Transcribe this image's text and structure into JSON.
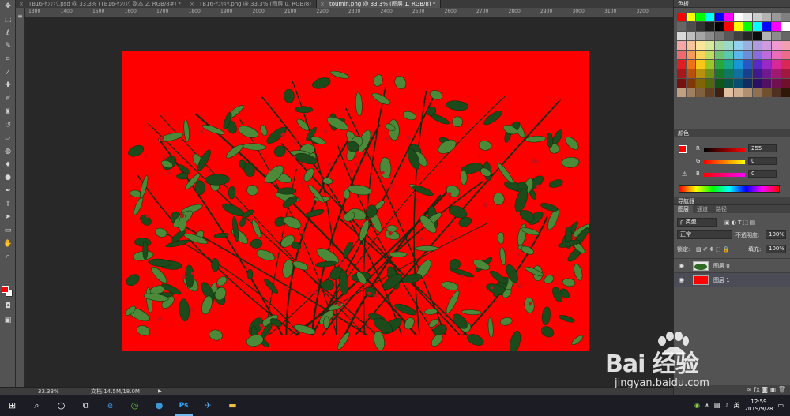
{
  "tabs": [
    {
      "label": "TB16-ｾﾝﾘｮｳ.psd @ 33.3% (TB16-ｾﾝﾘｮｳ 副本 2, RGB/8#) *",
      "active": false
    },
    {
      "label": "TB16-ｾﾝﾘｮｳ.png @ 33.3% (图层 0, RGB/8)",
      "active": false
    },
    {
      "label": "toumin.png @ 33.3% (图层 1, RGB/8) *",
      "active": true
    }
  ],
  "ruler_ticks": [
    "1300",
    "1400",
    "1500",
    "1600",
    "1700",
    "1800",
    "1900",
    "2000",
    "2100",
    "2200",
    "2300",
    "2400",
    "2500",
    "2600",
    "2700",
    "2800",
    "2900",
    "3000",
    "3100",
    "3200"
  ],
  "status": {
    "zoom": "33.33%",
    "doc_info": "文档:14.5M/18.0M"
  },
  "panels": {
    "swatches_title": "色板",
    "color_title": "颜色",
    "color": {
      "r_label": "R",
      "g_label": "G",
      "b_label": "B",
      "r": "255",
      "g": "0",
      "b": "0"
    },
    "navigator_title": "导航器",
    "layers_tabs": [
      "图层",
      "通道",
      "路径"
    ],
    "kind_filter": "ρ 类型",
    "blend_mode": "正常",
    "opacity_label": "不透明度:",
    "opacity": "100%",
    "lock_label": "锁定:",
    "fill_label": "填充:",
    "fill": "100%",
    "layers": [
      {
        "name": "图层 0",
        "thumb": "plant",
        "selected": false
      },
      {
        "name": "图层 1",
        "thumb": "red",
        "selected": true
      }
    ]
  },
  "taskbar": {
    "clock_time": "12:59",
    "clock_date": "2019/9/28",
    "ime": "英"
  },
  "watermark": {
    "brand": "Bai 经验",
    "url": "jingyan.baidu.com"
  },
  "colors": {
    "canvas_fill": "#ff0000",
    "plant_dark": "#1d4a1a",
    "plant_light": "#4c8a3a",
    "berry": "#c8101a"
  }
}
